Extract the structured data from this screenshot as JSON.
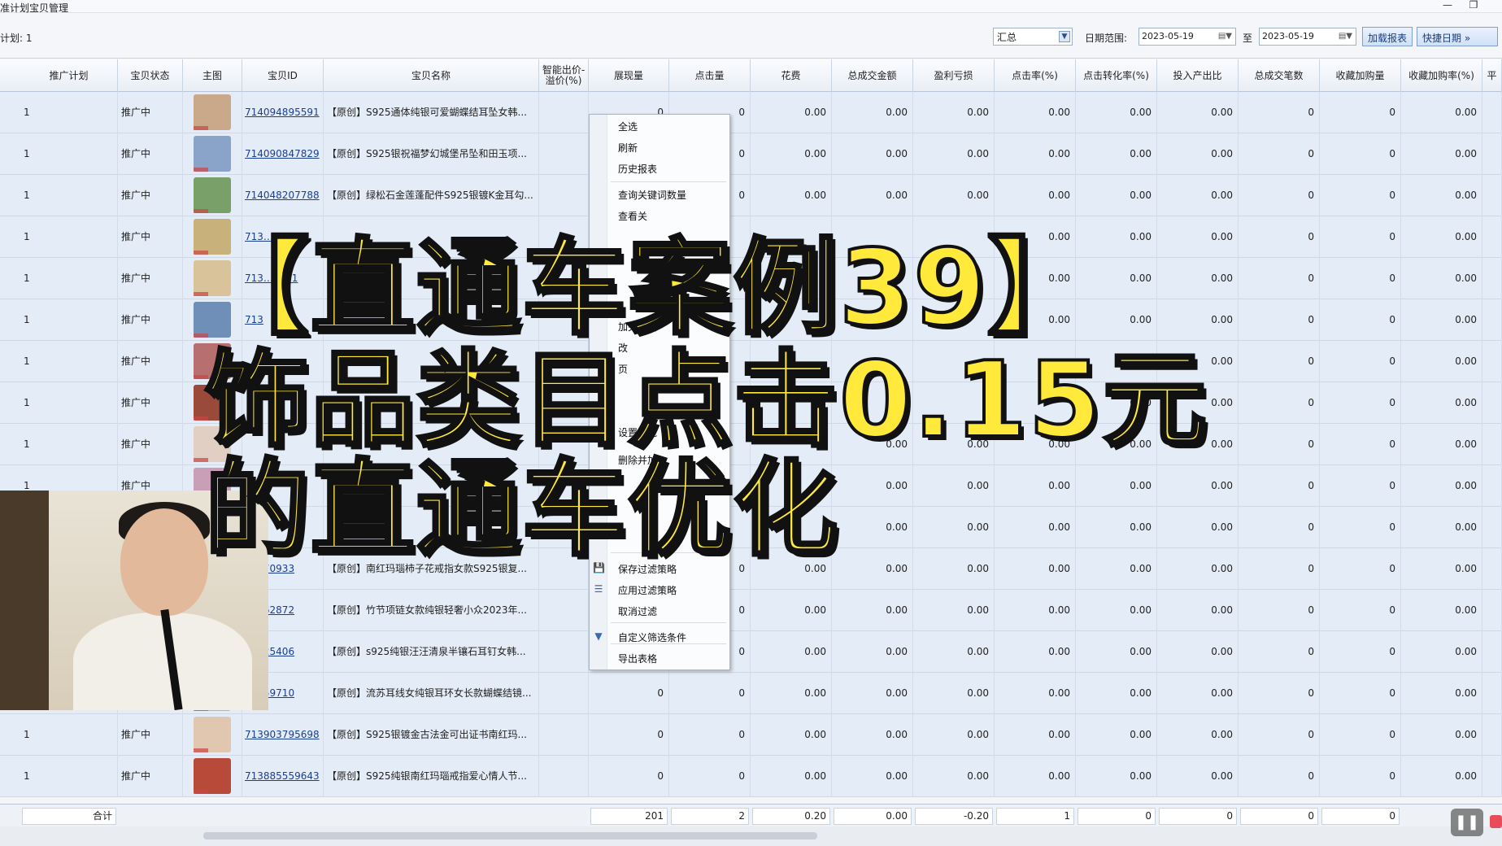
{
  "window": {
    "title": "推广计划宝贝管理",
    "title_prefix": "准计划宝贝管理"
  },
  "toolbar": {
    "plan_count": "计划: 1",
    "period_value": "汇总",
    "date_range_label": "日期范围:",
    "date_from": "2023-05-19",
    "to_label": "至",
    "date_to": "2023-05-19",
    "load_report_label": "加载报表",
    "quick_date_label": "快捷日期"
  },
  "table": {
    "columns": [
      "推广计划",
      "宝贝状态",
      "主图",
      "宝贝ID",
      "宝贝名称",
      "智能出价-\n溢价(%)",
      "展现量",
      "点击量",
      "花费",
      "总成交金额",
      "盈利亏损",
      "点击率(%)",
      "点击转化率(%)",
      "投入产出比",
      "总成交笔数",
      "收藏加购量",
      "收藏加购率(%)",
      "平"
    ],
    "rows": [
      {
        "plan": "1",
        "status": "推广中",
        "id": "714094895591",
        "name": "【原创】S925通体纯银可爱蝴蝶结耳坠女韩...",
        "impressions": "0",
        "clicks": "0",
        "cost": "0.00",
        "gmv": "0.00",
        "profit": "0.00",
        "ctr": "0.00",
        "cvr": "0.00",
        "roi": "0.00",
        "orders": "0",
        "fav": "0",
        "favrate": "0.00"
      },
      {
        "plan": "1",
        "status": "推广中",
        "id": "714090847829",
        "name": "【原创】S925银祝福梦幻城堡吊坠和田玉项...",
        "impressions": "",
        "clicks": "0",
        "cost": "0.00",
        "gmv": "0.00",
        "profit": "0.00",
        "ctr": "0.00",
        "cvr": "0.00",
        "roi": "0.00",
        "orders": "0",
        "fav": "0",
        "favrate": "0.00"
      },
      {
        "plan": "1",
        "status": "推广中",
        "id": "714048207788",
        "name": "【原创】绿松石金莲蓬配件S925银镀K金耳勾...",
        "impressions": "",
        "clicks": "0",
        "cost": "0.00",
        "gmv": "0.00",
        "profit": "0.00",
        "ctr": "0.00",
        "cvr": "0.00",
        "roi": "0.00",
        "orders": "0",
        "fav": "0",
        "favrate": "0.00"
      },
      {
        "plan": "1",
        "status": "推广中",
        "id": "713…440",
        "name": "",
        "impressions": "",
        "clicks": "",
        "cost": "",
        "gmv": "",
        "profit": "",
        "ctr": "0.00",
        "cvr": "0.00",
        "roi": "0.00",
        "orders": "0",
        "fav": "0",
        "favrate": "0.00"
      },
      {
        "plan": "1",
        "status": "推广中",
        "id": "713…7431",
        "name": "",
        "impressions": "",
        "clicks": "",
        "cost": "",
        "gmv": "",
        "profit": "",
        "ctr": "0.00",
        "cvr": "0.00",
        "roi": "0.00",
        "orders": "0",
        "fav": "0",
        "favrate": "0.00"
      },
      {
        "plan": "1",
        "status": "推广中",
        "id": "713",
        "name": "",
        "impressions": "",
        "clicks": "",
        "cost": "",
        "gmv": "",
        "profit": "",
        "ctr": "0.00",
        "cvr": "0.00",
        "roi": "0.00",
        "orders": "0",
        "fav": "0",
        "favrate": "0.00"
      },
      {
        "plan": "1",
        "status": "推广中",
        "id": "",
        "name": "",
        "impressions": "",
        "clicks": "",
        "cost": "",
        "gmv": "",
        "profit": "",
        "ctr": "",
        "cvr": "0.00",
        "roi": "0.00",
        "orders": "0",
        "fav": "0",
        "favrate": "0.00"
      },
      {
        "plan": "1",
        "status": "推广中",
        "id": "",
        "name": "",
        "impressions": "",
        "clicks": "",
        "cost": "",
        "gmv": "",
        "profit": "",
        "ctr": "",
        "cvr": "0.00",
        "roi": "0.00",
        "orders": "0",
        "fav": "0",
        "favrate": "0.00"
      },
      {
        "plan": "1",
        "status": "推广中",
        "id": "",
        "name": "",
        "impressions": "",
        "clicks": "",
        "cost": "",
        "gmv": "0.00",
        "profit": "0.00",
        "ctr": "0.00",
        "cvr": "0.00",
        "roi": "0.00",
        "orders": "0",
        "fav": "0",
        "favrate": "0.00"
      },
      {
        "plan": "1",
        "status": "推广中",
        "id": "",
        "name": "",
        "impressions": "",
        "clicks": "",
        "cost": "",
        "gmv": "0.00",
        "profit": "0.00",
        "ctr": "0.00",
        "cvr": "0.00",
        "roi": "0.00",
        "orders": "0",
        "fav": "0",
        "favrate": "0.00"
      },
      {
        "plan": "",
        "status": "",
        "id": "",
        "name": "",
        "impressions": "",
        "clicks": "",
        "cost": "",
        "gmv": "0.00",
        "profit": "0.00",
        "ctr": "0.00",
        "cvr": "0.00",
        "roi": "0.00",
        "orders": "0",
        "fav": "0",
        "favrate": "0.00"
      },
      {
        "plan": "",
        "status": "",
        "id": "04870933",
        "name": "【原创】南红玛瑙柿子花戒指女款S925银复...",
        "impressions": "",
        "clicks": "0",
        "cost": "0.00",
        "gmv": "0.00",
        "profit": "0.00",
        "ctr": "0.00",
        "cvr": "0.00",
        "roi": "0.00",
        "orders": "0",
        "fav": "0",
        "favrate": "0.00"
      },
      {
        "plan": "",
        "status": "",
        "id": "91162872",
        "name": "【原创】竹节项链女款纯银轻奢小众2023年...",
        "impressions": "",
        "clicks": "0",
        "cost": "0.00",
        "gmv": "0.00",
        "profit": "0.00",
        "ctr": "0.00",
        "cvr": "0.00",
        "roi": "0.00",
        "orders": "0",
        "fav": "0",
        "favrate": "0.00"
      },
      {
        "plan": "",
        "status": "",
        "id": "91525406",
        "name": "【原创】s925纯银汪汪清泉半镶石耳钉女韩...",
        "impressions": "",
        "clicks": "0",
        "cost": "0.00",
        "gmv": "0.00",
        "profit": "0.00",
        "ctr": "0.00",
        "cvr": "0.00",
        "roi": "0.00",
        "orders": "0",
        "fav": "0",
        "favrate": "0.00"
      },
      {
        "plan": "",
        "status": "",
        "id": "23759710",
        "name": "【原创】流苏耳线女纯银耳环女长款蝴蝶结镜...",
        "impressions": "0",
        "clicks": "0",
        "cost": "0.00",
        "gmv": "0.00",
        "profit": "0.00",
        "ctr": "0.00",
        "cvr": "0.00",
        "roi": "0.00",
        "orders": "0",
        "fav": "0",
        "favrate": "0.00"
      },
      {
        "plan": "1",
        "status": "推广中",
        "id": "713903795698",
        "name": "【原创】S925银镀金古法金可出证书南红玛...",
        "impressions": "0",
        "clicks": "0",
        "cost": "0.00",
        "gmv": "0.00",
        "profit": "0.00",
        "ctr": "0.00",
        "cvr": "0.00",
        "roi": "0.00",
        "orders": "0",
        "fav": "0",
        "favrate": "0.00"
      },
      {
        "plan": "1",
        "status": "推广中",
        "id": "713885559643",
        "name": "【原创】S925纯银南红玛瑙戒指爱心情人节...",
        "impressions": "0",
        "clicks": "0",
        "cost": "0.00",
        "gmv": "0.00",
        "profit": "0.00",
        "ctr": "0.00",
        "cvr": "0.00",
        "roi": "0.00",
        "orders": "0",
        "fav": "0",
        "favrate": "0.00"
      }
    ],
    "totals": {
      "label": "合计",
      "impressions": "201",
      "clicks": "2",
      "cost": "0.20",
      "gmv": "0.00",
      "profit": "-0.20",
      "ctr": "1",
      "cvr": "0",
      "roi": "0",
      "orders": "0",
      "fav": "0"
    }
  },
  "context_menu": {
    "items": [
      "全选",
      "刷新",
      "历史报表",
      "查询关键词数量",
      "查看关",
      "加关键词",
      "改",
      "页",
      "",
      "设置智能",
      "删除并加",
      "保存过滤策略",
      "应用过滤策略",
      "取消过滤",
      "自定义筛选条件",
      "导出表格"
    ]
  },
  "overlay": {
    "line1": "【直通车案例39】",
    "line2": "饰品类目点击0.15元",
    "line3": "的直通车优化"
  },
  "colors": {
    "headline_fill": "#ffe93a",
    "headline_stroke": "#111111",
    "row_bg": "#e4ecf7",
    "link": "#1b3f8f"
  }
}
